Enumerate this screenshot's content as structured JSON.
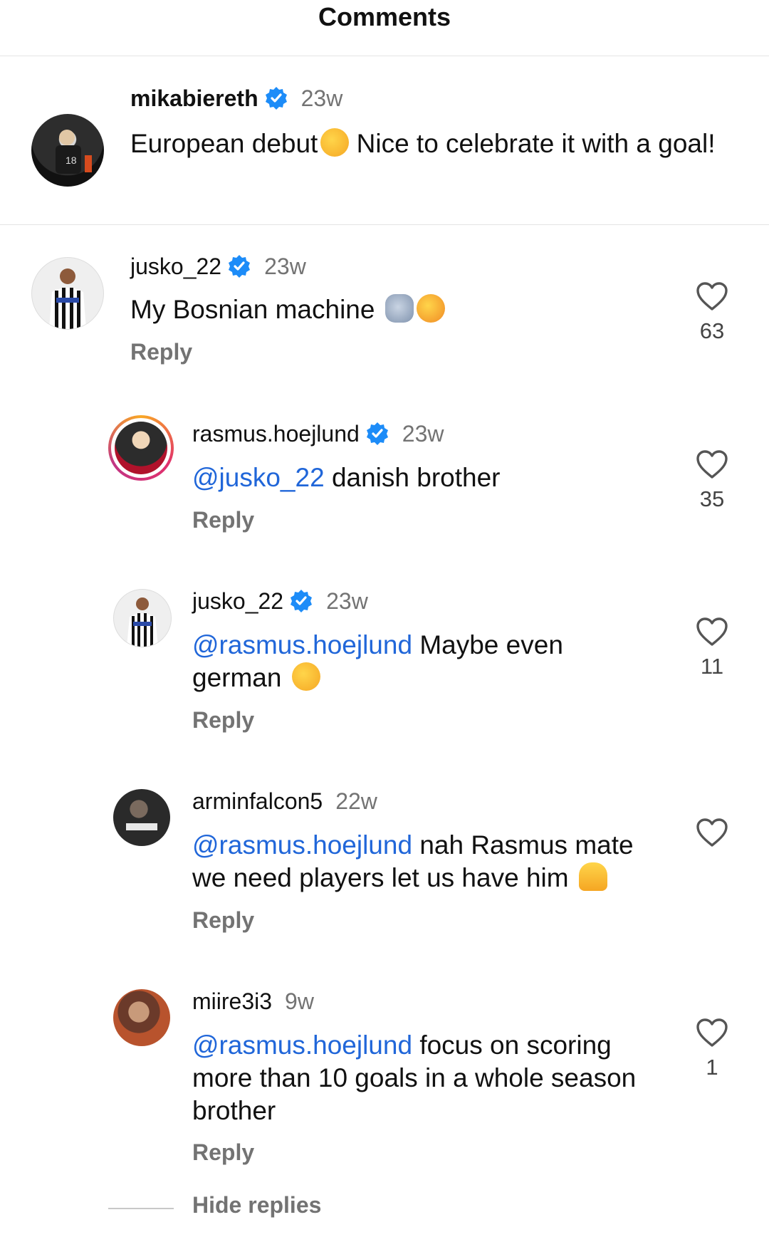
{
  "header": {
    "title": "Comments"
  },
  "caption": {
    "username": "mikabiereth",
    "time": "23w",
    "text_a": "European debut",
    "text_b": " Nice to celebrate it with a goal!"
  },
  "comments": [
    {
      "username": "jusko_22",
      "time": "23w",
      "verified": true,
      "mention": "",
      "text": "My Bosnian machine ",
      "reply": "Reply",
      "likes": "63"
    },
    {
      "username": "rasmus.hoejlund",
      "time": "23w",
      "verified": true,
      "mention": "@jusko_22",
      "text": " danish brother",
      "reply": "Reply",
      "likes": "35"
    },
    {
      "username": "jusko_22",
      "time": "23w",
      "verified": true,
      "mention": "@rasmus.hoejlund",
      "text": " Maybe even german ",
      "reply": "Reply",
      "likes": "11"
    },
    {
      "username": "arminfalcon5",
      "time": "22w",
      "verified": false,
      "mention": "@rasmus.hoejlund",
      "text": " nah Rasmus mate we need players let us have him ",
      "reply": "Reply",
      "likes": ""
    },
    {
      "username": "miire3i3",
      "time": "9w",
      "verified": false,
      "mention": "@rasmus.hoejlund",
      "text": " focus on scoring more than 10 goals in a whole season brother",
      "reply": "Reply",
      "likes": "1"
    }
  ],
  "footer": {
    "hide_replies": "Hide replies"
  },
  "colors": {
    "link": "#2066d9",
    "verified": "#1d8cf8",
    "muted": "#737373"
  }
}
